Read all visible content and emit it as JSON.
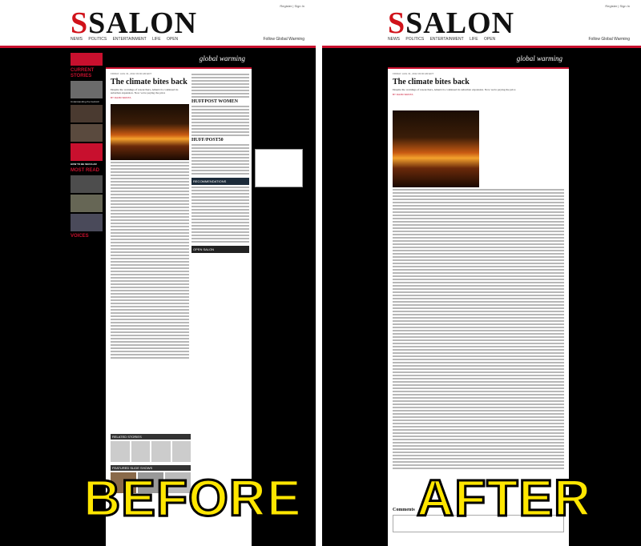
{
  "before": {
    "label": "BEFORE",
    "site_logo": "SALON",
    "nav": [
      "NEWS",
      "POLITICS",
      "ENTERTAINMENT",
      "LIFE",
      "OPEN"
    ],
    "follow": "Follow Global Warming",
    "section_label": "global warming",
    "article": {
      "date": "FRIDAY, AUG 31, 2012 03:00 AM EDT",
      "headline": "The climate bites back",
      "dek": "Despite the warnings of researchers, America's continued its suburban expansion. Now we're paying the price",
      "byline": "BY DAVID SIROTA"
    },
    "rail": {
      "huffpost_women": "HUFFPOST WOMEN",
      "huffpost50": "HUFF/POST50",
      "recommendations": "RECOMMENDATIONS",
      "open_salon": "OPEN SALON"
    },
    "left_sections": [
      "CURRENT STORIES",
      "MOST READ",
      "VOICES"
    ],
    "left_badge": "HOW TO BE SECULAR",
    "related": "RELATED STORIES",
    "featured": "FEATURED SLIDE SHOWS"
  },
  "after": {
    "label": "AFTER",
    "site_logo": "SALON",
    "nav": [
      "NEWS",
      "POLITICS",
      "ENTERTAINMENT",
      "LIFE",
      "OPEN"
    ],
    "follow": "Follow Global Warming",
    "section_label": "global warming",
    "article": {
      "date": "FRIDAY, AUG 31, 2012 03:00 AM EDT",
      "headline": "The climate bites back",
      "dek": "Despite the warnings of researchers, America's continued its suburban expansion. Now we're paying the price",
      "byline": "BY DAVID SIROTA"
    },
    "comments_title": "Comments"
  }
}
